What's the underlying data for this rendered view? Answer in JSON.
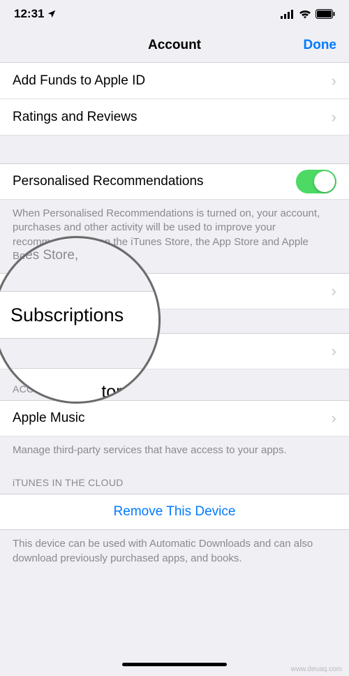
{
  "status": {
    "time": "12:31",
    "location_icon": "loc"
  },
  "nav": {
    "title": "Account",
    "done": "Done"
  },
  "rows": {
    "add_funds": "Add Funds to Apple ID",
    "ratings": "Ratings and Reviews",
    "personalised": "Personalised Recommendations",
    "subscriptions": "Subscriptions",
    "purchase_history": "Purchase History",
    "apple_music": "Apple Music",
    "remove_device": "Remove This Device"
  },
  "footers": {
    "personalised": "When Personalised Recommendations is turned on, your account, purchases and other activity will be used to improve your recommendations on the iTunes Store, the App Store and Apple Books.",
    "account_access": "Manage third-party services that have access to your apps.",
    "cloud": "This device can be used with Automatic Downloads and can also download previously purchased apps, and books."
  },
  "headers": {
    "account_access": "ACCOUNT ACCESS",
    "cloud": "iTUNES IN THE CLOUD"
  },
  "magnifier": {
    "above_fragment": "unes Store,",
    "label": "Subscriptions",
    "history_fragment": "tory"
  },
  "watermark": "www.deuaq.com"
}
